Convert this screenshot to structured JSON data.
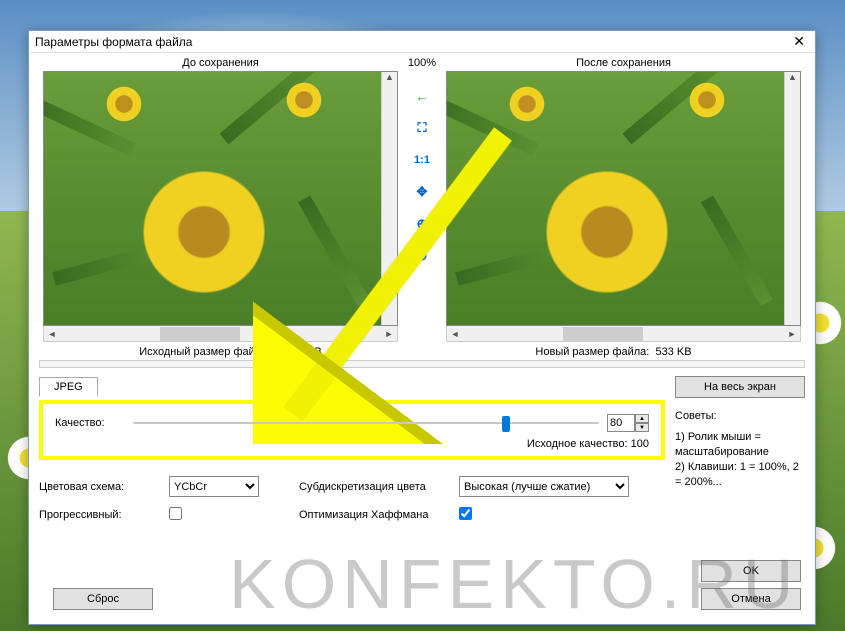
{
  "dialog": {
    "title": "Параметры формата файла",
    "close": "✕"
  },
  "preview": {
    "before_label": "До сохранения",
    "after_label": "После сохранения",
    "zoom": "100%",
    "orig_size_label": "Исходный размер файла:",
    "orig_size_value": "2 165 KB",
    "new_size_label": "Новый размер файла:",
    "new_size_value": "533 KB"
  },
  "tools": {
    "fit": "⛶",
    "one_to_one": "1:1",
    "pan": "✥",
    "zoom_in": "⊕",
    "zoom_out": "⊖",
    "back": "←"
  },
  "tab": {
    "jpeg": "JPEG"
  },
  "quality": {
    "label": "Качество:",
    "value": "80",
    "orig_label": "Исходное качество:",
    "orig_value": "100"
  },
  "color": {
    "scheme_label": "Цветовая схема:",
    "scheme_value": "YCbCr",
    "subsamp_label": "Субдискретизация цвета",
    "subsamp_value": "Высокая (лучше сжатие)",
    "progressive_label": "Прогрессивный:",
    "huffman_label": "Оптимизация Хаффмана"
  },
  "buttons": {
    "fullscreen": "На весь экран",
    "ok": "OK",
    "cancel": "Отмена",
    "reset": "Сброс"
  },
  "hints": {
    "title": "Советы:",
    "line1": "1) Ролик мыши = масштабирование",
    "line2": "2) Клавиши: 1 = 100%, 2 = 200%..."
  },
  "watermark": "KONFEKTO.RU"
}
